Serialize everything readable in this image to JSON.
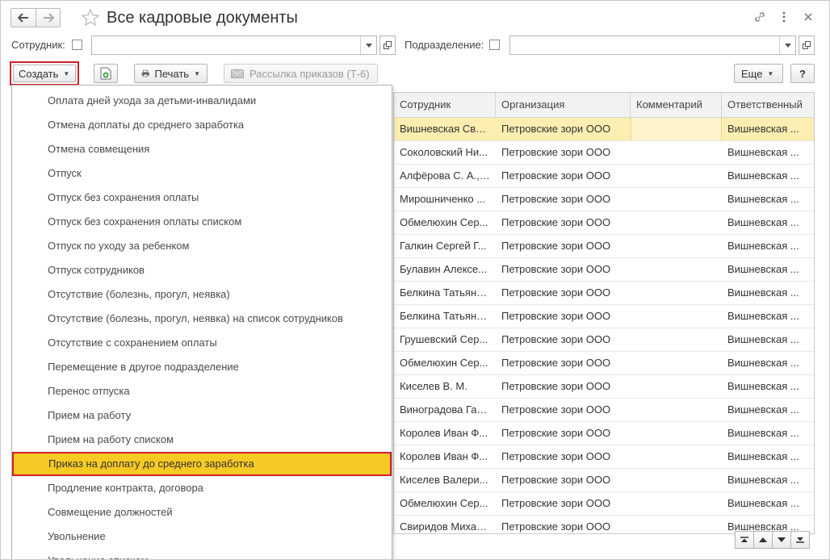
{
  "window": {
    "title": "Все кадровые документы"
  },
  "filters": {
    "employee_label": "Сотрудник:",
    "employee_value": "",
    "department_label": "Подразделение:",
    "department_value": ""
  },
  "toolbar": {
    "create_label": "Создать",
    "print_label": "Печать",
    "mailing_label": "Рассылка приказов (Т-6)",
    "more_label": "Еще",
    "help_label": "?"
  },
  "table": {
    "columns": [
      "Сотрудник",
      "Организация",
      "Комментарий",
      "Ответственный"
    ],
    "rows": [
      [
        "Вишневская Све...",
        "Петровские зори ООО",
        "",
        "Вишневская ..."
      ],
      [
        "Соколовский Ни...",
        "Петровские зори ООО",
        "",
        "Вишневская ..."
      ],
      [
        "Алфёрова С. А., ...",
        "Петровские зори ООО",
        "",
        "Вишневская ..."
      ],
      [
        "Мирошниченко ...",
        "Петровские зори ООО",
        "",
        "Вишневская ..."
      ],
      [
        "Обмелюхин Сер...",
        "Петровские зори ООО",
        "",
        "Вишневская ..."
      ],
      [
        "Галкин Сергей Г...",
        "Петровские зори ООО",
        "",
        "Вишневская ..."
      ],
      [
        "Булавин Алексе...",
        "Петровские зори ООО",
        "",
        "Вишневская ..."
      ],
      [
        "Белкина Татьяна...",
        "Петровские зори ООО",
        "",
        "Вишневская ..."
      ],
      [
        "Белкина Татьяна...",
        "Петровские зори ООО",
        "",
        "Вишневская ..."
      ],
      [
        "Грушевский Сер...",
        "Петровские зори ООО",
        "",
        "Вишневская ..."
      ],
      [
        "Обмелюхин Сер...",
        "Петровские зори ООО",
        "",
        "Вишневская ..."
      ],
      [
        "Киселев В. М.",
        "Петровские зори ООО",
        "",
        "Вишневская ..."
      ],
      [
        "Виноградова Гал...",
        "Петровские зори ООО",
        "",
        "Вишневская ..."
      ],
      [
        "Королев Иван Ф...",
        "Петровские зори ООО",
        "",
        "Вишневская ..."
      ],
      [
        "Королев Иван Ф...",
        "Петровские зори ООО",
        "",
        "Вишневская ..."
      ],
      [
        "Киселев Валери...",
        "Петровские зори ООО",
        "",
        "Вишневская ..."
      ],
      [
        "Обмелюхин Сер...",
        "Петровские зори ООО",
        "",
        "Вишневская ..."
      ],
      [
        "Свиридов Михаи...",
        "Петровские зори ООО",
        "",
        "Вишневская ..."
      ]
    ]
  },
  "menu": {
    "items": [
      "Оплата дней ухода за детьми-инвалидами",
      "Отмена доплаты до среднего заработка",
      "Отмена совмещения",
      "Отпуск",
      "Отпуск без сохранения оплаты",
      "Отпуск без сохранения оплаты списком",
      "Отпуск по уходу за ребенком",
      "Отпуск сотрудников",
      "Отсутствие (болезнь, прогул, неявка)",
      "Отсутствие (болезнь, прогул, неявка) на список сотрудников",
      "Отсутствие с сохранением оплаты",
      "Перемещение в другое подразделение",
      "Перенос отпуска",
      "Прием на работу",
      "Прием на работу списком",
      "Приказ на доплату до среднего заработка",
      "Продление контракта, договора",
      "Совмещение должностей",
      "Увольнение",
      "Увольнение списком"
    ],
    "highlighted_index": 15
  },
  "colors": {
    "highlight_fill": "#f7c924",
    "highlight_border": "#d4202a",
    "selected_row": "#fbeeb0"
  }
}
